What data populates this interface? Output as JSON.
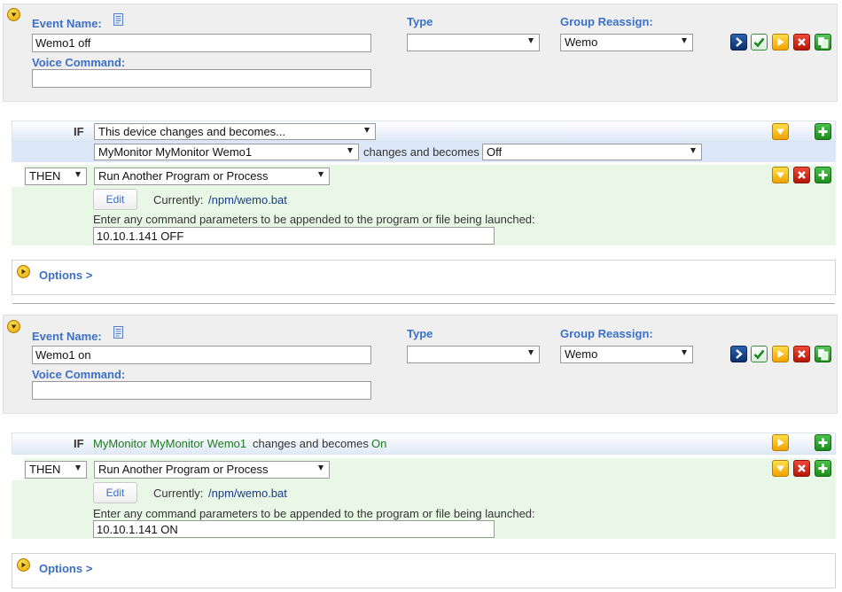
{
  "colors": {
    "accent": "#3c70c6",
    "if_bar": "#dce8f7",
    "then_bar": "#e9f8e6",
    "device_link": "#1f7a1f",
    "path_link": "#1a3a8a"
  },
  "events": [
    {
      "collapse_icon": "chevron-down-circle-icon",
      "event_name_label": "Event Name:",
      "event_name_value": "Wemo1 off",
      "voice_command_label": "Voice Command:",
      "voice_command_value": "",
      "type_label": "Type",
      "type_value": "",
      "group_label": "Group Reassign:",
      "group_value": "Wemo",
      "if_label": "IF",
      "trigger_select": "This device changes and becomes...",
      "device_select": "MyMonitor MyMonitor Wemo1",
      "changes_text": "changes and becomes",
      "state_select": "Off",
      "then_select": "THEN",
      "action_select": "Run Another Program or Process",
      "edit_label": "Edit",
      "currently_label": "Currently:",
      "currently_value": "/npm/wemo.bat",
      "params_label": "Enter any command parameters to be appended to the program or file being launched:",
      "params_value": "10.10.1.141 OFF",
      "options_label": "Options >"
    },
    {
      "collapse_icon": "chevron-down-circle-icon",
      "event_name_label": "Event Name:",
      "event_name_value": "Wemo1 on",
      "voice_command_label": "Voice Command:",
      "voice_command_value": "",
      "type_label": "Type",
      "type_value": "",
      "group_label": "Group Reassign:",
      "group_value": "Wemo",
      "if_label": "IF",
      "if_device": "MyMonitor MyMonitor Wemo1",
      "if_changes_text": "changes and becomes",
      "if_state": "On",
      "then_select": "THEN",
      "action_select": "Run Another Program or Process",
      "edit_label": "Edit",
      "currently_label": "Currently:",
      "currently_value": "/npm/wemo.bat",
      "params_label": "Enter any command parameters to be appended to the program or file being launched:",
      "params_value": "10.10.1.141 ON",
      "options_label": "Options >"
    }
  ]
}
